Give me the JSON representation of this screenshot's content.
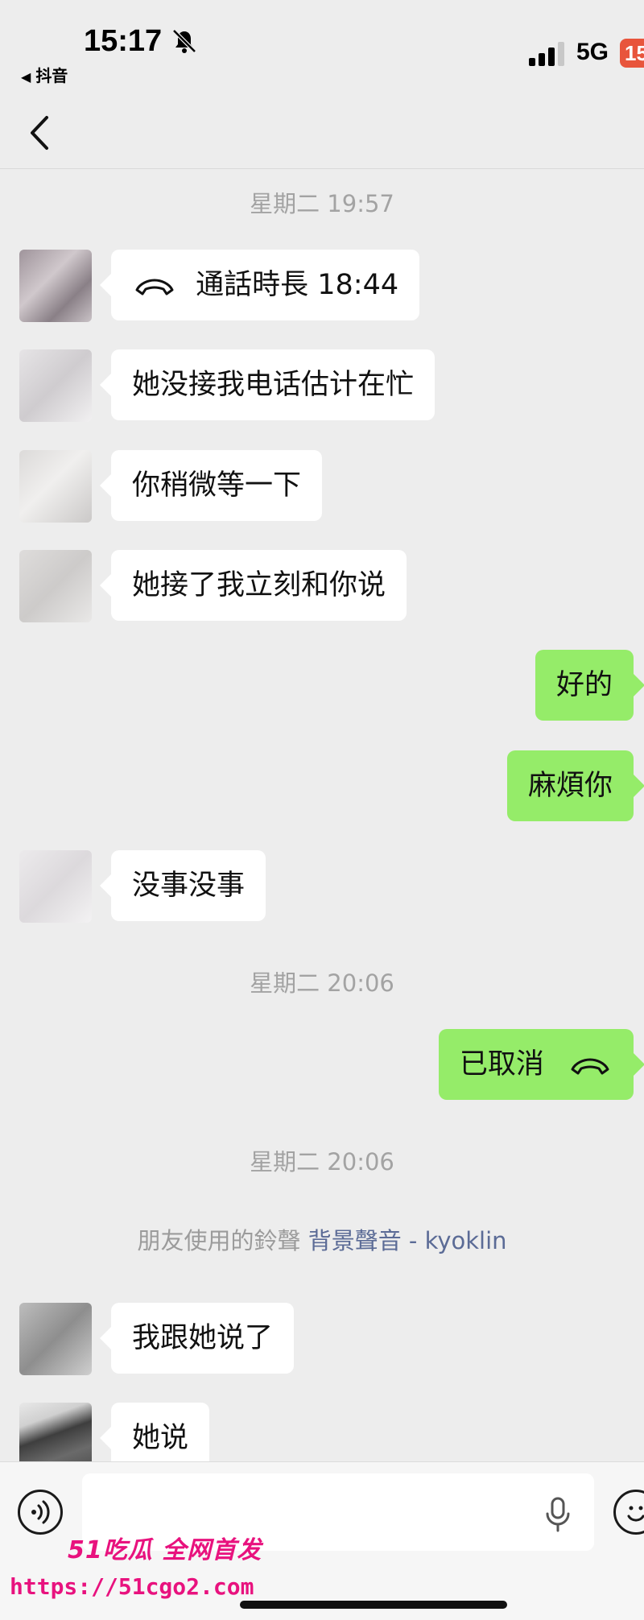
{
  "status": {
    "time": "15:17",
    "back_app": "抖音",
    "network": "5G",
    "battery": "15"
  },
  "messages": [
    {
      "type": "timestamp",
      "text": "星期二 19:57"
    },
    {
      "type": "call-in",
      "text": "通話時長 18:44"
    },
    {
      "type": "in",
      "text": "她没接我电话估计在忙"
    },
    {
      "type": "in",
      "text": "你稍微等一下"
    },
    {
      "type": "in",
      "text": "她接了我立刻和你说"
    },
    {
      "type": "out",
      "text": "好的"
    },
    {
      "type": "out",
      "text": "麻煩你"
    },
    {
      "type": "in",
      "text": "没事没事"
    },
    {
      "type": "timestamp",
      "text": "星期二 20:06"
    },
    {
      "type": "call-out",
      "text": "已取消"
    },
    {
      "type": "timestamp",
      "text": "星期二 20:06"
    },
    {
      "type": "system",
      "prefix": "朋友使用的鈴聲",
      "link": "背景聲音 - kyoklin"
    },
    {
      "type": "in",
      "text": "我跟她说了"
    },
    {
      "type": "in",
      "text": "她说"
    }
  ],
  "watermark": {
    "title": "51吃瓜 全网首发",
    "url": "https://51cgo2.com"
  },
  "icons": [
    "bell-muted-icon",
    "signal-icon",
    "back-chevron-icon",
    "phone-icon",
    "voice-icon",
    "mic-icon",
    "emoji-icon"
  ]
}
